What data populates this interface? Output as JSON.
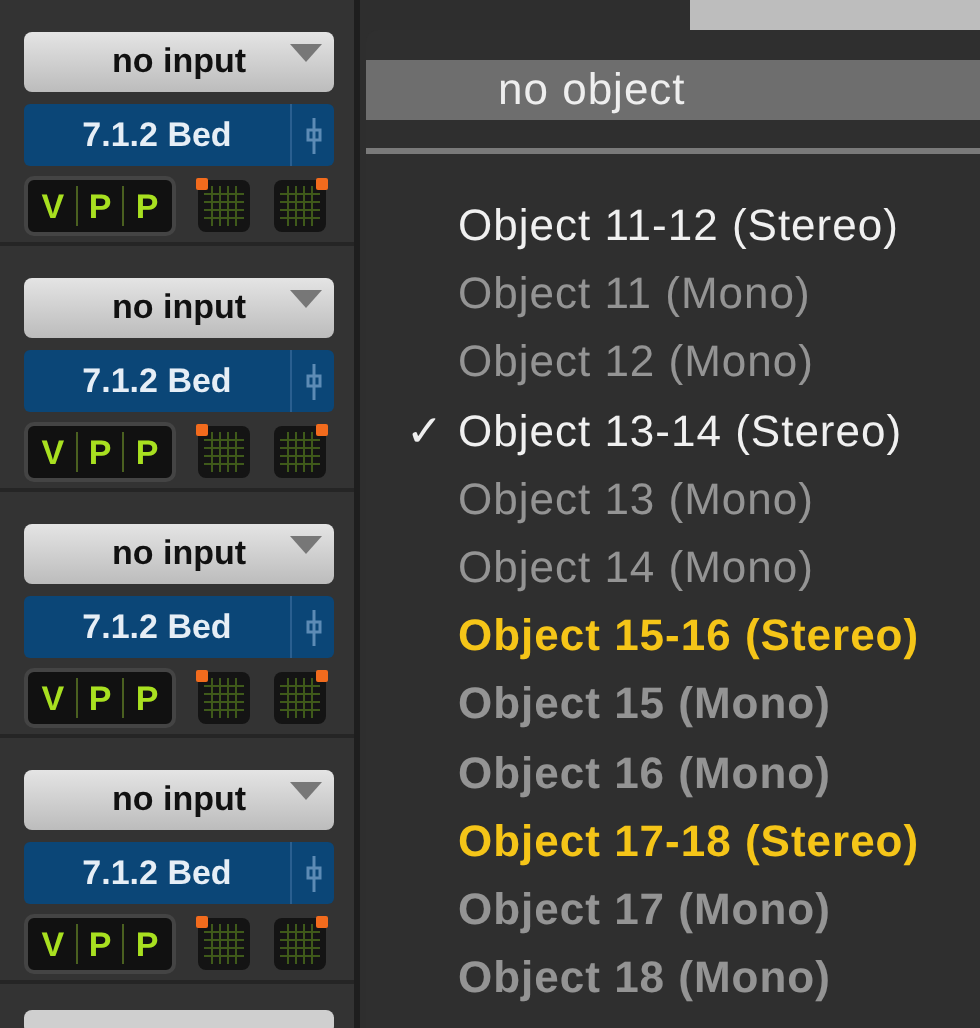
{
  "channels": [
    {
      "input": "no input",
      "format": "7.1.2 Bed",
      "vpp": [
        "V",
        "P",
        "P"
      ]
    },
    {
      "input": "no input",
      "format": "7.1.2 Bed",
      "vpp": [
        "V",
        "P",
        "P"
      ]
    },
    {
      "input": "no input",
      "format": "7.1.2 Bed",
      "vpp": [
        "V",
        "P",
        "P"
      ]
    },
    {
      "input": "no input",
      "format": "7.1.2 Bed",
      "vpp": [
        "V",
        "P",
        "P"
      ]
    }
  ],
  "menu": {
    "header": "no object",
    "check_mark": "✓",
    "items": [
      {
        "label": "Object 11-12 (Stereo)",
        "checked": false,
        "disabled": false,
        "highlighted": false,
        "bold": false
      },
      {
        "label": "Object 11 (Mono)",
        "checked": false,
        "disabled": true,
        "highlighted": false,
        "bold": false
      },
      {
        "label": "Object 12 (Mono)",
        "checked": false,
        "disabled": true,
        "highlighted": false,
        "bold": false
      },
      {
        "label": "Object 13-14 (Stereo)",
        "checked": true,
        "disabled": false,
        "highlighted": false,
        "bold": false
      },
      {
        "label": "Object 13 (Mono)",
        "checked": false,
        "disabled": true,
        "highlighted": false,
        "bold": false
      },
      {
        "label": "Object 14 (Mono)",
        "checked": false,
        "disabled": true,
        "highlighted": false,
        "bold": false
      },
      {
        "label": "Object 15-16 (Stereo)",
        "checked": false,
        "disabled": false,
        "highlighted": true,
        "bold": true
      },
      {
        "label": "Object 15 (Mono)",
        "checked": false,
        "disabled": true,
        "highlighted": false,
        "bold": true
      },
      {
        "label": "Object 16 (Mono)",
        "checked": false,
        "disabled": true,
        "highlighted": false,
        "bold": true
      },
      {
        "label": "Object 17-18 (Stereo)",
        "checked": false,
        "disabled": false,
        "highlighted": true,
        "bold": true
      },
      {
        "label": "Object 17 (Mono)",
        "checked": false,
        "disabled": true,
        "highlighted": false,
        "bold": true
      },
      {
        "label": "Object 18 (Mono)",
        "checked": false,
        "disabled": true,
        "highlighted": false,
        "bold": true
      }
    ]
  }
}
